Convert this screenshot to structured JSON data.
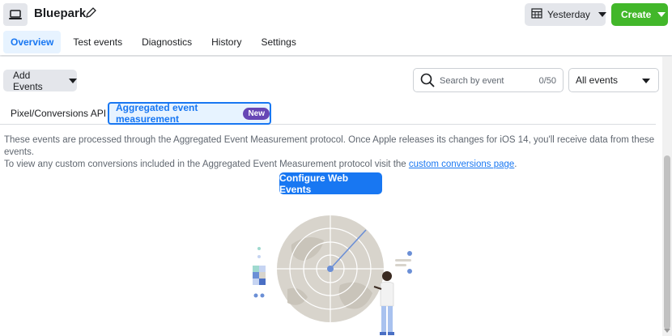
{
  "header": {
    "title": "Bluepark",
    "date_button": "Yesterday",
    "create_button": "Create"
  },
  "tabs": [
    {
      "label": "Overview"
    },
    {
      "label": "Test events"
    },
    {
      "label": "Diagnostics"
    },
    {
      "label": "History"
    },
    {
      "label": "Settings"
    }
  ],
  "toolbar": {
    "add_events": "Add Events",
    "search_placeholder": "Search by event",
    "search_count": "0/50",
    "filter_value": "All events"
  },
  "subtabs": {
    "pixel": "Pixel/Conversions API",
    "aggregated": "Aggregated event measurement",
    "new_badge": "New"
  },
  "description": {
    "line1": "These events are processed through the Aggregated Event Measurement protocol. Once Apple releases its changes for iOS 14, you'll receive data from these events.",
    "line2_prefix": "To view any custom conversions included in the Aggregated Event Measurement protocol visit the ",
    "link": "custom conversions page",
    "line2_suffix": "."
  },
  "configure_button": "Configure Web Events",
  "colors": {
    "accent": "#1877f2",
    "create_green": "#42b72a",
    "badge_purple": "#6747b5"
  }
}
